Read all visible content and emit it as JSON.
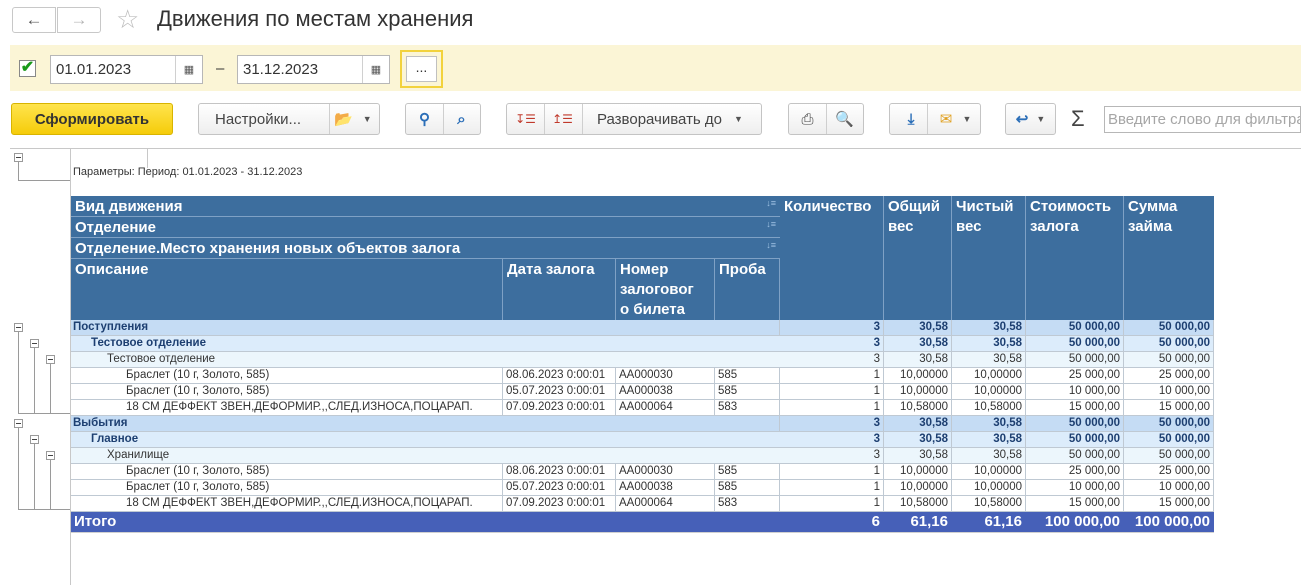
{
  "header": {
    "title": "Движения по местам хранения",
    "back_icon": "arrow-left-icon",
    "forward_icon": "arrow-right-icon",
    "favorite_icon": "star-icon"
  },
  "period": {
    "enabled": true,
    "date_from": "01.01.2023",
    "separator": "–",
    "date_to": "31.12.2023",
    "choose_label": "..."
  },
  "toolbar": {
    "generate_label": "Сформировать",
    "settings_label": "Настройки...",
    "expand_label": "Разворачивать до",
    "search_placeholder": "Введите слово для фильтра",
    "sum_symbol": "Σ"
  },
  "report": {
    "params_text": "Параметры:   Период: 01.01.2023 - 31.12.2023",
    "columns": {
      "group1": "Вид движения",
      "group2": "Отделение",
      "group3": "Отделение.Место хранения новых объектов залога",
      "description": "Описание",
      "pledge_date": "Дата залога",
      "ticket_lines": [
        "Номер",
        "залоговог",
        "о билета"
      ],
      "probe": "Проба",
      "quantity": "Количество",
      "gross_lines": [
        "Общий",
        "вес"
      ],
      "net_lines": [
        "Чистый",
        "вес"
      ],
      "value_lines": [
        "Стоимость",
        "залога"
      ],
      "loan_lines": [
        "Сумма",
        "займа"
      ]
    },
    "rows": [
      {
        "level": 1,
        "description": "Поступления",
        "date": "",
        "ticket": "",
        "probe": "",
        "qty": "3",
        "gross": "30,58",
        "net": "30,58",
        "value": "50 000,00",
        "loan": "50 000,00"
      },
      {
        "level": 2,
        "description": "Тестовое отделение",
        "date": "",
        "ticket": "",
        "probe": "",
        "qty": "3",
        "gross": "30,58",
        "net": "30,58",
        "value": "50 000,00",
        "loan": "50 000,00"
      },
      {
        "level": 3,
        "description": "Тестовое отделение",
        "date": "",
        "ticket": "",
        "probe": "",
        "qty": "3",
        "gross": "30,58",
        "net": "30,58",
        "value": "50 000,00",
        "loan": "50 000,00"
      },
      {
        "level": 4,
        "description": "Браслет (10 г, Золото, 585)",
        "date": "08.06.2023 0:00:01",
        "ticket": "АА000030",
        "probe": "585",
        "qty": "1",
        "gross": "10,00000",
        "net": "10,00000",
        "value": "25 000,00",
        "loan": "25 000,00"
      },
      {
        "level": 4,
        "description": "Браслет (10 г, Золото, 585)",
        "date": "05.07.2023 0:00:01",
        "ticket": "АА000038",
        "probe": "585",
        "qty": "1",
        "gross": "10,00000",
        "net": "10,00000",
        "value": "10 000,00",
        "loan": "10 000,00"
      },
      {
        "level": 4,
        "description": "18 СМ ДЕФФЕКТ ЗВЕН,ДЕФОРМИР.,,СЛЕД.ИЗНОСА,ПОЦАРАП.",
        "date": "07.09.2023 0:00:01",
        "ticket": "АА000064",
        "probe": "583",
        "qty": "1",
        "gross": "10,58000",
        "net": "10,58000",
        "value": "15 000,00",
        "loan": "15 000,00"
      },
      {
        "level": 1,
        "description": "Выбытия",
        "date": "",
        "ticket": "",
        "probe": "",
        "qty": "3",
        "gross": "30,58",
        "net": "30,58",
        "value": "50 000,00",
        "loan": "50 000,00"
      },
      {
        "level": 2,
        "description": "Главное",
        "date": "",
        "ticket": "",
        "probe": "",
        "qty": "3",
        "gross": "30,58",
        "net": "30,58",
        "value": "50 000,00",
        "loan": "50 000,00"
      },
      {
        "level": 3,
        "description": "Хранилище",
        "date": "",
        "ticket": "",
        "probe": "",
        "qty": "3",
        "gross": "30,58",
        "net": "30,58",
        "value": "50 000,00",
        "loan": "50 000,00"
      },
      {
        "level": 4,
        "description": "Браслет (10 г, Золото, 585)",
        "date": "08.06.2023 0:00:01",
        "ticket": "АА000030",
        "probe": "585",
        "qty": "1",
        "gross": "10,00000",
        "net": "10,00000",
        "value": "25 000,00",
        "loan": "25 000,00"
      },
      {
        "level": 4,
        "description": "Браслет (10 г, Золото, 585)",
        "date": "05.07.2023 0:00:01",
        "ticket": "АА000038",
        "probe": "585",
        "qty": "1",
        "gross": "10,00000",
        "net": "10,00000",
        "value": "10 000,00",
        "loan": "10 000,00"
      },
      {
        "level": 4,
        "description": "18 СМ ДЕФФЕКТ ЗВЕН,ДЕФОРМИР.,,СЛЕД.ИЗНОСА,ПОЦАРАП.",
        "date": "07.09.2023 0:00:01",
        "ticket": "АА000064",
        "probe": "583",
        "qty": "1",
        "gross": "10,58000",
        "net": "10,58000",
        "value": "15 000,00",
        "loan": "15 000,00"
      }
    ],
    "total": {
      "label": "Итого",
      "qty": "6",
      "gross": "61,16",
      "net": "61,16",
      "value": "100 000,00",
      "loan": "100 000,00"
    }
  }
}
